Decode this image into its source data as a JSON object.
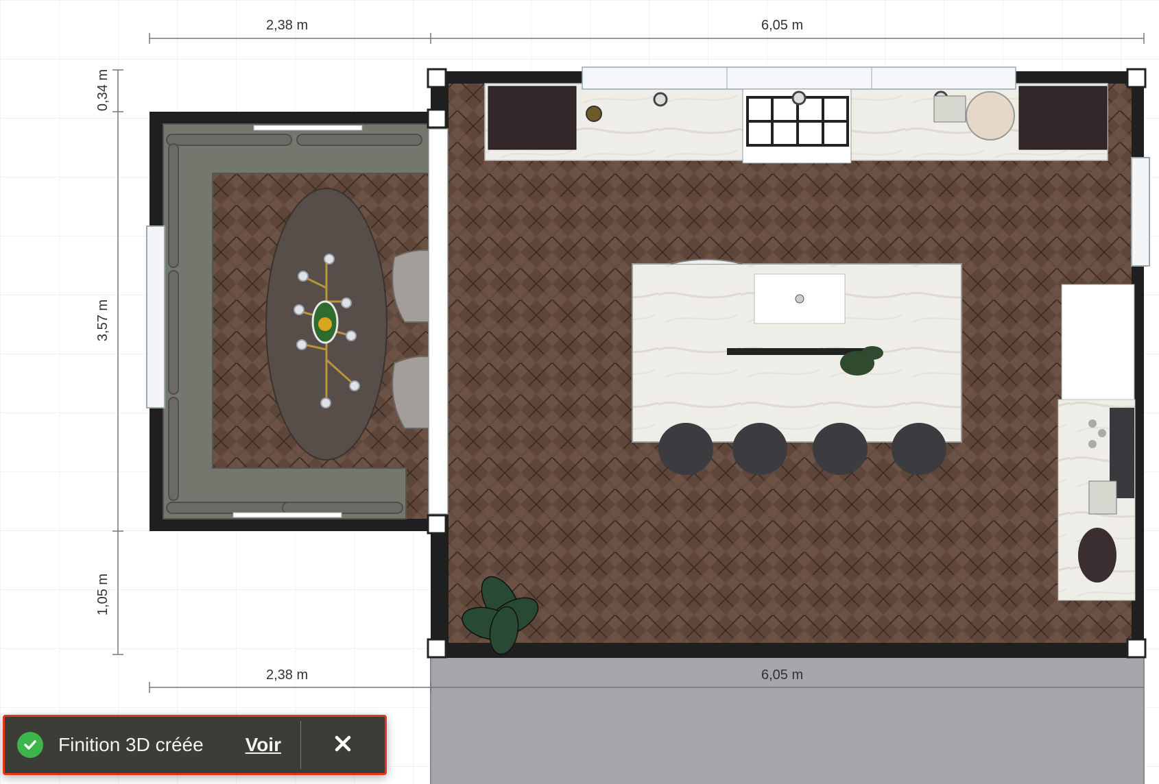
{
  "plan": {
    "dimensions": {
      "top_left": "2,38 m",
      "top_right": "6,05 m",
      "left_top": "0,34 m",
      "left_middle": "3,57 m",
      "left_bottom": "1,05 m",
      "bottom_left": "2,38 m",
      "bottom_right": "6,05 m"
    },
    "colors": {
      "wall": "#1f1f1f",
      "floor": "#5b4538",
      "countertop": "#ecebe6",
      "bench": "#74776d",
      "terrace": "#a4a6ab",
      "grid": "#ececec"
    }
  },
  "toast": {
    "message": "Finition 3D créée",
    "action_label": "Voir",
    "status_icon": "check-circle-icon",
    "close_icon": "close-icon",
    "success_color": "#3cb54a",
    "highlight_color": "#e8331f"
  }
}
